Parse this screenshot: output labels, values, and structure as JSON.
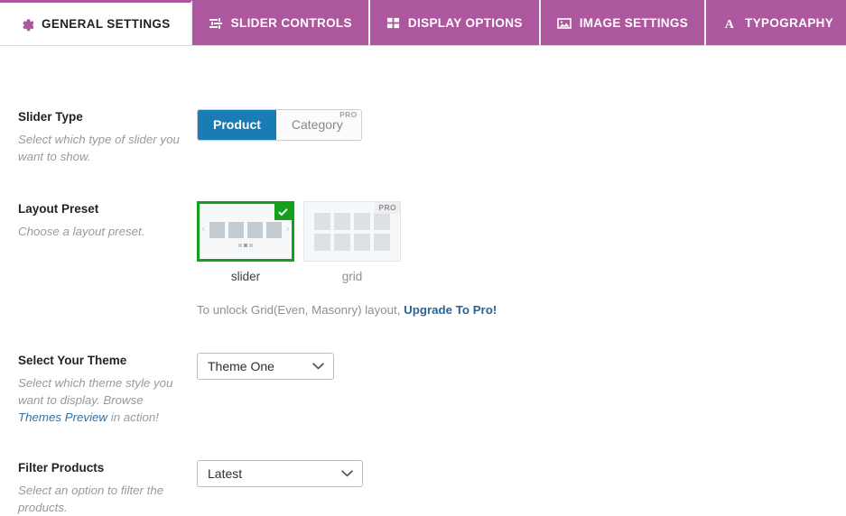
{
  "tabs": [
    {
      "label": "GENERAL SETTINGS",
      "icon": "gear-icon",
      "active": true
    },
    {
      "label": "SLIDER CONTROLS",
      "icon": "sliders-icon",
      "active": false
    },
    {
      "label": "DISPLAY OPTIONS",
      "icon": "grid-icon",
      "active": false
    },
    {
      "label": "IMAGE SETTINGS",
      "icon": "image-icon",
      "active": false
    },
    {
      "label": "TYPOGRAPHY",
      "icon": "text-a-icon",
      "active": false
    }
  ],
  "colors": {
    "tab_purple": "#ad589e",
    "toggle_active_blue": "#1a7cb5",
    "selected_green": "#14a01a",
    "link_blue": "#2a6496"
  },
  "fields": {
    "slider_type": {
      "title": "Slider Type",
      "description": "Select which type of slider you want to show.",
      "options": [
        {
          "label": "Product",
          "selected": true,
          "pro": ""
        },
        {
          "label": "Category",
          "selected": false,
          "pro": "PRO"
        }
      ]
    },
    "layout_preset": {
      "title": "Layout Preset",
      "description": "Choose a layout preset.",
      "presets": [
        {
          "name": "slider",
          "selected": true,
          "pro": ""
        },
        {
          "name": "grid",
          "selected": false,
          "pro": "PRO"
        }
      ],
      "unlock_text": "To unlock Grid(Even, Masonry) layout,",
      "unlock_link": "Upgrade To Pro!"
    },
    "theme": {
      "title": "Select Your Theme",
      "description_part1": "Select which theme style you want to display. Browse",
      "description_link": "Themes Preview",
      "description_part2": "in action!",
      "value": "Theme One"
    },
    "filter": {
      "title": "Filter Products",
      "description": "Select an option to filter the products.",
      "value": "Latest"
    }
  }
}
